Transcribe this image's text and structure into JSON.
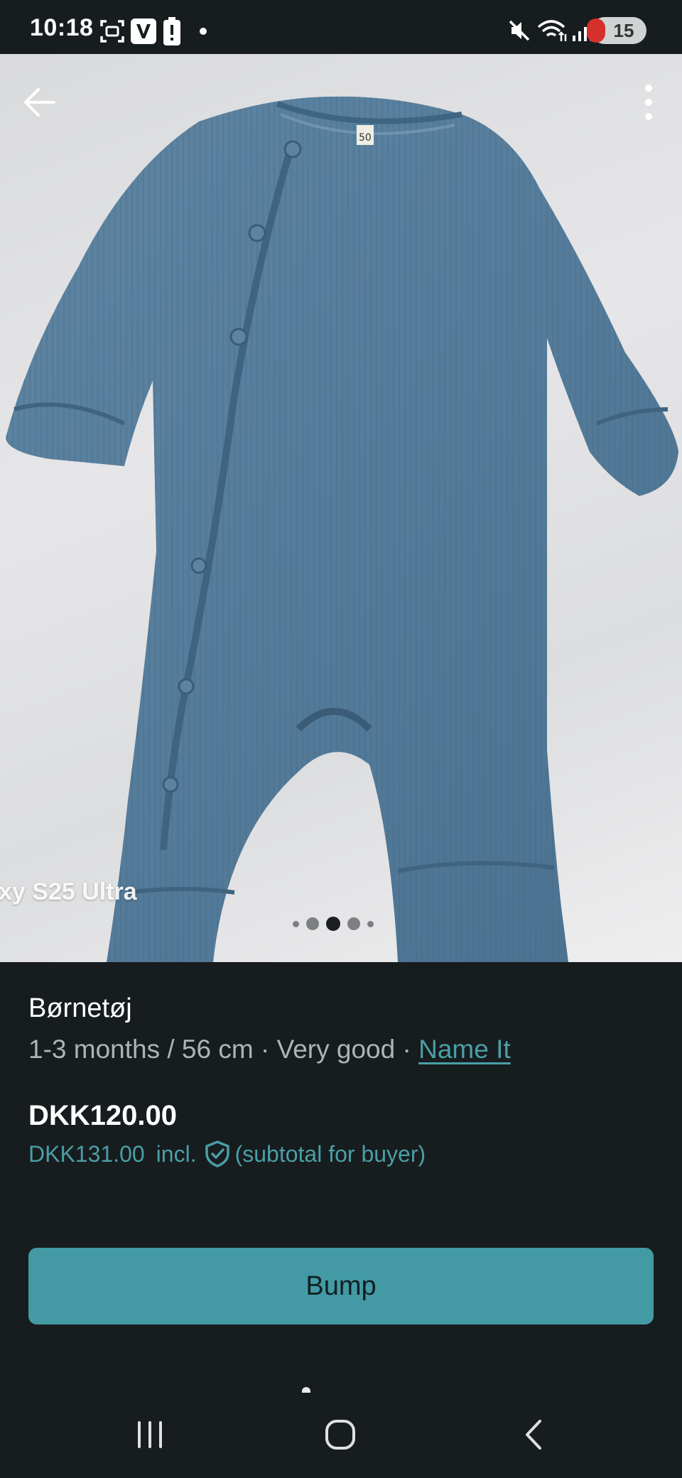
{
  "status_bar": {
    "time": "10:18",
    "battery_level": "15",
    "icons": [
      "screenshot-icon",
      "v-app-icon",
      "battery-alert-icon",
      "notification-dot-icon",
      "mute-icon",
      "wifi-icon",
      "signal-icon",
      "battery-saver-icon"
    ]
  },
  "photo": {
    "watermark": "xy S25 Ultra",
    "carousel": {
      "count": 5,
      "active_index": 2
    }
  },
  "listing": {
    "title": "Børnetøj",
    "size": "1-3 months / 56 cm",
    "separator": "·",
    "condition": "Very good",
    "brand": "Name It",
    "price": "DKK120.00",
    "buyer_price": "DKK131.00",
    "incl_label": "incl.",
    "subtotal_note": "(subtotal for buyer)"
  },
  "actions": {
    "bump_label": "Bump"
  },
  "colors": {
    "background": "#171c1e",
    "accent": "#439aa4",
    "link": "#4a9fa6",
    "secondary_text": "#aeb4b6"
  }
}
